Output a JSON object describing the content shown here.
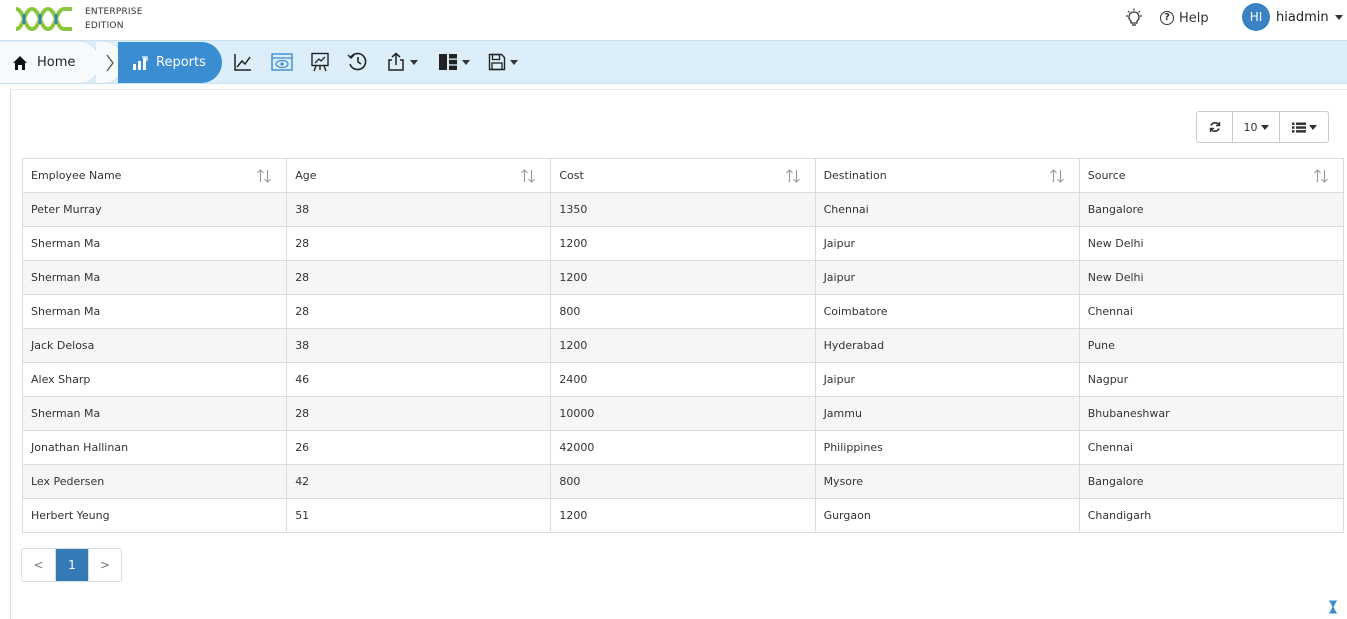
{
  "header": {
    "edition_line1": "ENTERPRISE",
    "edition_line2": "EDITION",
    "help_label": "Help",
    "avatar_initials": "HI",
    "username": "hiadmin"
  },
  "breadcrumb": {
    "home_label": "Home",
    "reports_label": "Reports"
  },
  "toolbar_icons": [
    "line-chart-icon",
    "preview-icon",
    "presentation-icon",
    "history-icon",
    "export-icon",
    "layout-icon",
    "save-icon"
  ],
  "table_controls": {
    "page_size": "10"
  },
  "table": {
    "columns": [
      "Employee Name",
      "Age",
      "Cost",
      "Destination",
      "Source"
    ],
    "rows": [
      [
        "Peter Murray",
        "38",
        "1350",
        "Chennai",
        "Bangalore"
      ],
      [
        "Sherman Ma",
        "28",
        "1200",
        "Jaipur",
        "New Delhi"
      ],
      [
        "Sherman Ma",
        "28",
        "1200",
        "Jaipur",
        "New Delhi"
      ],
      [
        "Sherman Ma",
        "28",
        "800",
        "Coimbatore",
        "Chennai"
      ],
      [
        "Jack Delosa",
        "38",
        "1200",
        "Hyderabad",
        "Pune"
      ],
      [
        "Alex Sharp",
        "46",
        "2400",
        "Jaipur",
        "Nagpur"
      ],
      [
        "Sherman Ma",
        "28",
        "10000",
        "Jammu",
        "Bhubaneshwar"
      ],
      [
        "Jonathan Hallinan",
        "26",
        "42000",
        "Philippines",
        "Chennai"
      ],
      [
        "Lex Pedersen",
        "42",
        "800",
        "Mysore",
        "Bangalore"
      ],
      [
        "Herbert Yeung",
        "51",
        "1200",
        "Gurgaon",
        "Chandigarh"
      ]
    ]
  },
  "pagination": {
    "prev": "<",
    "current": "1",
    "next": ">"
  },
  "colors": {
    "accent": "#3a8dd0",
    "toolbar_bg": "#dceef9",
    "logo_green": "#8dc63f",
    "logo_blue": "#2a7dc2"
  }
}
